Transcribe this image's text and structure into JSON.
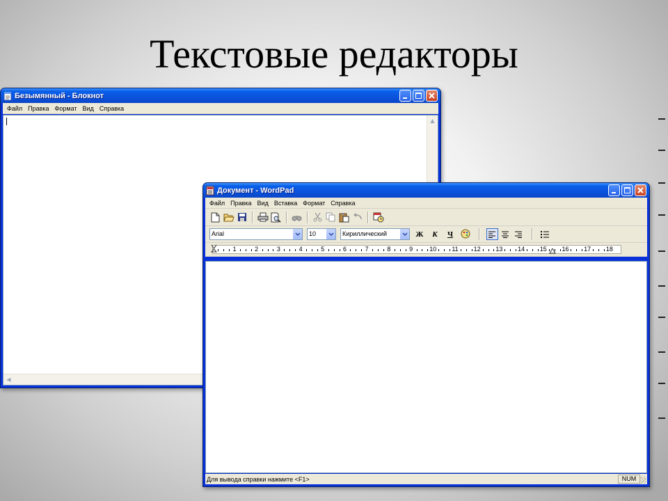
{
  "slide": {
    "title": "Текстовые редакторы"
  },
  "notepad": {
    "title": "Безымянный - Блокнот",
    "icon": "notepad-icon",
    "menu": [
      "Файл",
      "Правка",
      "Формат",
      "Вид",
      "Справка"
    ],
    "content": ""
  },
  "wordpad": {
    "title": "Документ - WordPad",
    "icon": "wordpad-icon",
    "menu": [
      "Файл",
      "Правка",
      "Вид",
      "Вставка",
      "Формат",
      "Справка"
    ],
    "toolbar_icons": [
      "new-document-icon",
      "open-folder-icon",
      "save-icon",
      "print-icon",
      "print-preview-icon",
      "find-icon",
      "cut-icon",
      "copy-icon",
      "paste-icon",
      "undo-icon",
      "date-time-icon"
    ],
    "format": {
      "font": "Arial",
      "size": "10",
      "script": "Кириллический",
      "bold": "Ж",
      "italic": "К",
      "underline": "Ч"
    },
    "ruler_numbers": [
      "1",
      "2",
      "3",
      "4",
      "5",
      "6",
      "7",
      "8",
      "9",
      "10",
      "11",
      "12",
      "13",
      "14",
      "15",
      "16",
      "17",
      "18"
    ],
    "status_text": "Для вывода справки нажмите <F1>",
    "status_num": "NUM",
    "content": ""
  },
  "colors": {
    "xp_blue": "#0831d9",
    "chrome": "#ece9d8",
    "close_red": "#c9401f"
  }
}
